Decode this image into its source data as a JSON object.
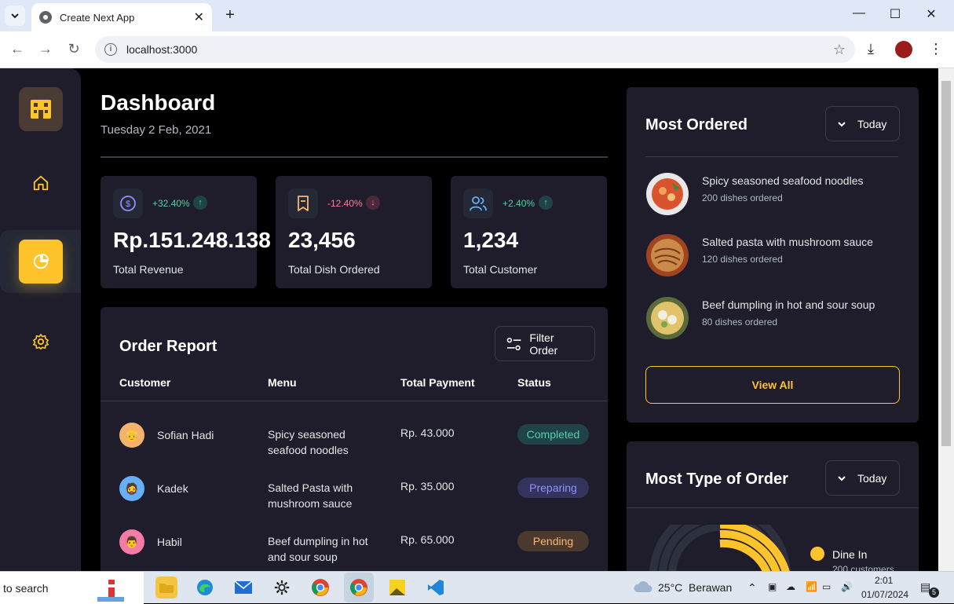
{
  "browser": {
    "tab_title": "Create Next App",
    "url": "localhost:3000"
  },
  "dashboard": {
    "title": "Dashboard",
    "date": "Tuesday 2 Feb, 2021",
    "stats": [
      {
        "change": "+32.40%",
        "direction": "up",
        "value": "Rp.151.248.138",
        "label": "Total Revenue",
        "icon": "dollar-icon"
      },
      {
        "change": "-12.40%",
        "direction": "down",
        "value": "23,456",
        "label": "Total Dish Ordered",
        "icon": "bookmark-icon"
      },
      {
        "change": "+2.40%",
        "direction": "up",
        "value": "1,234",
        "label": "Total Customer",
        "icon": "users-icon"
      }
    ]
  },
  "report": {
    "title": "Order Report",
    "filter_label": "Filter Order",
    "headers": [
      "Customer",
      "Menu",
      "Total Payment",
      "Status"
    ],
    "rows": [
      {
        "customer": "Sofian Hadi",
        "menu": "Spicy seasoned seafood noodles",
        "payment": "Rp. 43.000",
        "status": "Completed"
      },
      {
        "customer": "Kadek",
        "menu": "Salted Pasta with mushroom sauce",
        "payment": "Rp. 35.000",
        "status": "Preparing"
      },
      {
        "customer": "Habil",
        "menu": "Beef dumpling in hot and sour soup",
        "payment": "Rp. 65.000",
        "status": "Pending"
      }
    ]
  },
  "most_ordered": {
    "title": "Most Ordered",
    "filter": "Today",
    "items": [
      {
        "name": "Spicy seasoned seafood noodles",
        "count": "200 dishes ordered"
      },
      {
        "name": "Salted pasta with mushroom sauce",
        "count": "120 dishes ordered"
      },
      {
        "name": "Beef dumpling in hot and sour soup",
        "count": "80 dishes ordered"
      }
    ],
    "view_all": "View All"
  },
  "most_type": {
    "title": "Most Type of Order",
    "filter": "Today",
    "legend": [
      {
        "label": "Dine In",
        "sub": "200 customers",
        "color": "#ffc32b"
      }
    ]
  },
  "taskbar": {
    "search": "to search",
    "weather": "25°C",
    "weather_desc": "Berawan",
    "time": "2:01",
    "date": "01/07/2024",
    "notif_count": "5"
  },
  "colors": {
    "accent": "#ffc32b",
    "completed_bg": "#20434a",
    "completed_text": "#50d1aa",
    "preparing_bg": "#34335c",
    "preparing_text": "#9290fe",
    "pending_bg": "#4a3a2e",
    "pending_text": "#ffb572"
  }
}
